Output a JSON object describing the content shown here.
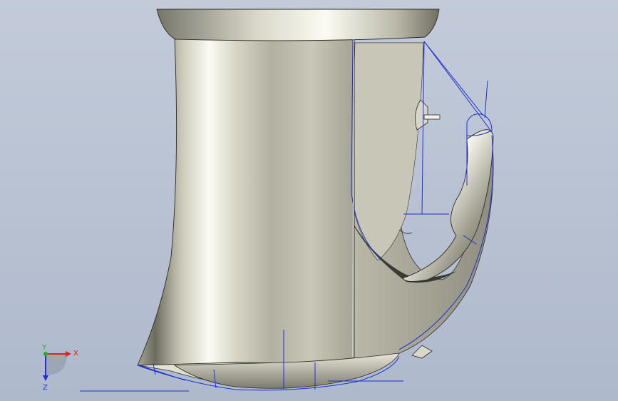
{
  "viewport": {
    "background_top": "#c3cbd9",
    "background_bottom": "#aeb9cc"
  },
  "model": {
    "surface_light": "#f4f4ec",
    "surface_mid": "#b9b8a8",
    "surface_dark": "#5e5d52",
    "edge_color": "#2b2b25",
    "sketch_color": "#1d2fd0"
  },
  "triad": {
    "x_label": "X",
    "y_label": "Y",
    "z_label": "Z",
    "x_color": "#e02020",
    "y_color": "#20b020",
    "z_color": "#2030d0"
  }
}
